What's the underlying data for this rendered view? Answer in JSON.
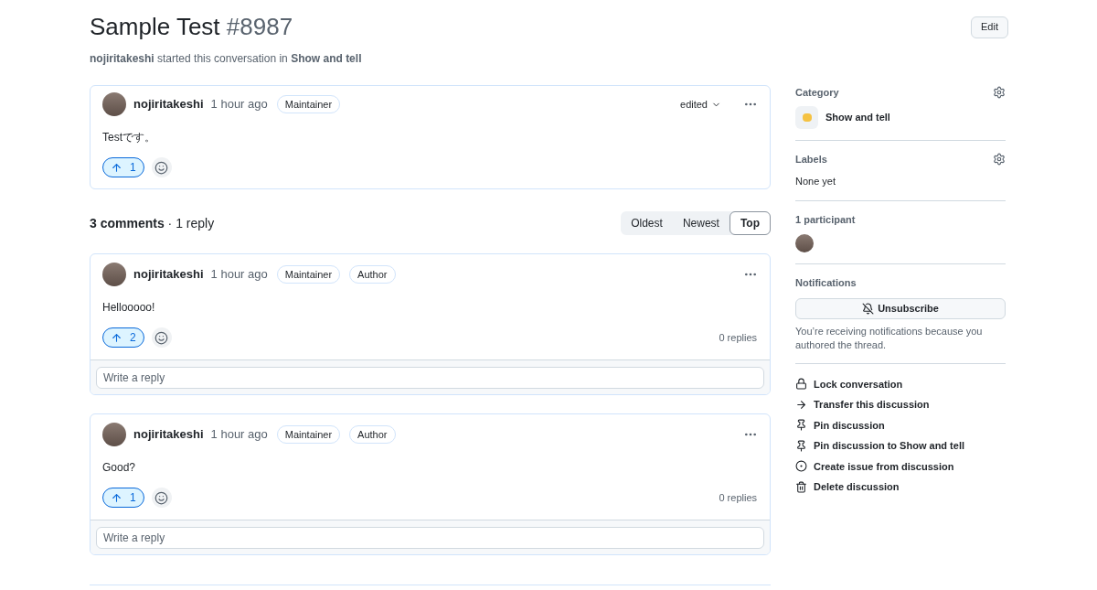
{
  "title": {
    "text": "Sample Test",
    "number": "#8987"
  },
  "edit_button": "Edit",
  "subtitle": {
    "author": "nojiritakeshi",
    "middle": "started this conversation in",
    "category": "Show and tell"
  },
  "post": {
    "author": "nojiritakeshi",
    "time": "1 hour ago",
    "badges": [
      "Maintainer"
    ],
    "edited": "edited",
    "body": "Testです。",
    "upvotes": "1",
    "voted": true
  },
  "comments_header": {
    "count": "3 comments",
    "separator": "·",
    "replies": "1 reply"
  },
  "sort_tabs": [
    {
      "label": "Oldest",
      "selected": false
    },
    {
      "label": "Newest",
      "selected": false
    },
    {
      "label": "Top",
      "selected": true
    }
  ],
  "comments": [
    {
      "author": "nojiritakeshi",
      "time": "1 hour ago",
      "badges": [
        "Maintainer",
        "Author"
      ],
      "body": "Hellooooo!",
      "upvotes": "2",
      "voted": true,
      "replies": "0 replies",
      "reply_placeholder": "Write a reply"
    },
    {
      "author": "nojiritakeshi",
      "time": "1 hour ago",
      "badges": [
        "Maintainer",
        "Author"
      ],
      "body": "Good?",
      "upvotes": "1",
      "voted": true,
      "replies": "0 replies",
      "reply_placeholder": "Write a reply"
    }
  ],
  "sidebar": {
    "category": {
      "heading": "Category",
      "value": "Show and tell"
    },
    "labels": {
      "heading": "Labels",
      "value": "None yet"
    },
    "participants": {
      "heading": "1 participant"
    },
    "notifications": {
      "heading": "Notifications",
      "button": "Unsubscribe",
      "note": "You’re receiving notifications because you authored the thread."
    },
    "actions": [
      {
        "kind": "lock",
        "label": "Lock conversation"
      },
      {
        "kind": "arrow",
        "label": "Transfer this discussion"
      },
      {
        "kind": "pin",
        "label": "Pin discussion"
      },
      {
        "kind": "pin",
        "label": "Pin discussion to Show and tell"
      },
      {
        "kind": "issue",
        "label": "Create issue from discussion"
      },
      {
        "kind": "trash",
        "label": "Delete discussion"
      }
    ]
  }
}
